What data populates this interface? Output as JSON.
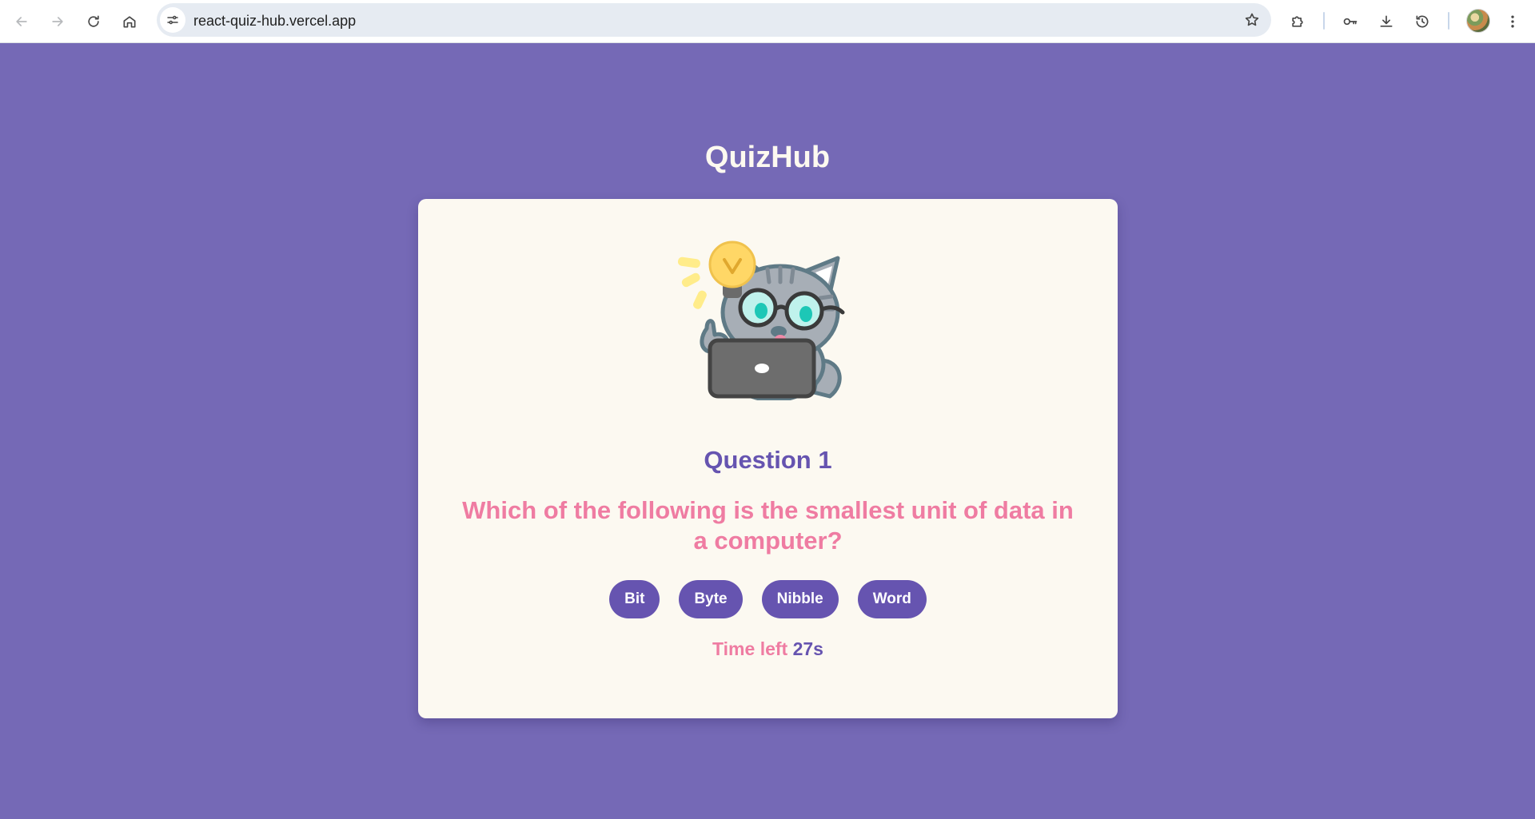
{
  "browser": {
    "url": "react-quiz-hub.vercel.app",
    "icons": {
      "back": "arrow-left-icon",
      "forward": "arrow-right-icon",
      "reload": "reload-icon",
      "home": "home-icon",
      "site_info": "tune-icon",
      "bookmark": "star-icon",
      "extensions": "puzzle-icon",
      "passwords": "key-icon",
      "downloads": "download-icon",
      "history": "history-icon",
      "profile": "avatar",
      "menu": "kebab-menu-icon"
    }
  },
  "app": {
    "title": "QuizHub",
    "background_color": "#7569b6",
    "card_color": "#fcf9f1",
    "accent_color": "#6654b0",
    "highlight_color": "#ef7ca2"
  },
  "quiz": {
    "mascot": "cat-with-glasses-laptop-lightbulb-illustration",
    "question_number": "Question 1",
    "question_text": "Which of the following is the smallest unit of data in a computer?",
    "answers": [
      "Bit",
      "Byte",
      "Nibble",
      "Word"
    ],
    "timer": {
      "label": "Time left",
      "value": "27s"
    }
  }
}
